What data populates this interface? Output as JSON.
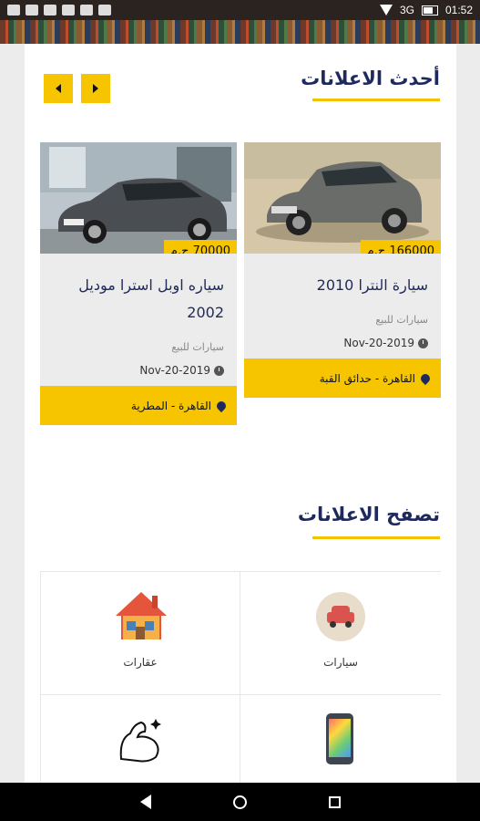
{
  "status_bar": {
    "network": "3G",
    "time": "01:52"
  },
  "sections": {
    "latest_title": "أحدث الاعلانات",
    "browse_title": "تصفح الاعلانات"
  },
  "listings": [
    {
      "price": "166000 ج.م",
      "title": "سيارة النترا 2010",
      "category": "سيارات للبيع",
      "date": "Nov-20-2019",
      "location": "القاهرة - حدائق القبة"
    },
    {
      "price": "70000 ج.م",
      "title": "سياره اوبل استرا موديل 2002",
      "category": "سيارات للبيع",
      "date": "Nov-20-2019",
      "location": "القاهرة - المطرية"
    }
  ],
  "categories": [
    {
      "label": "سيارات",
      "icon": "car-icon"
    },
    {
      "label": "عقارات",
      "icon": "house-icon"
    },
    {
      "label": "",
      "icon": "phone-icon"
    },
    {
      "label": "",
      "icon": "muscle-icon"
    }
  ],
  "colors": {
    "accent": "#f7c500",
    "navy": "#1e2a5c"
  }
}
